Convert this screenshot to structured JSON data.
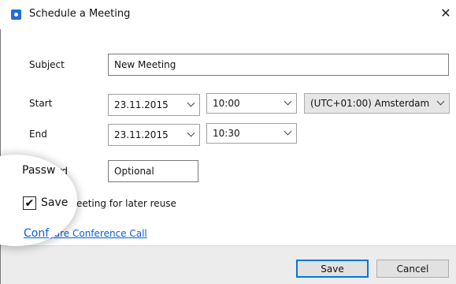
{
  "window": {
    "title": "Schedule a Meeting",
    "close_glyph": "✕",
    "app_icon": "teamviewer-icon"
  },
  "form": {
    "subject_label": "Subject",
    "subject_value": "New Meeting",
    "start_label": "Start",
    "start_date": "23.11.2015",
    "start_time": "10:00",
    "timezone": "(UTC+01:00) Amsterdam",
    "end_label": "End",
    "end_date": "23.11.2015",
    "end_time": "10:30",
    "password_label": "Password",
    "password_placeholder": "Optional",
    "save_meeting_label": "Save meeting for later reuse",
    "save_meeting_checked": true,
    "configure_link": "Configure Conference Call"
  },
  "footer": {
    "save_label": "Save",
    "cancel_label": "Cancel"
  },
  "magnifier": {
    "password_fragment": "Passw",
    "save_fragment": "Save",
    "link_fragment": "Conf"
  },
  "colors": {
    "accent": "#0078d7",
    "link": "#0b5fd6",
    "footer_bg": "#ececec"
  }
}
